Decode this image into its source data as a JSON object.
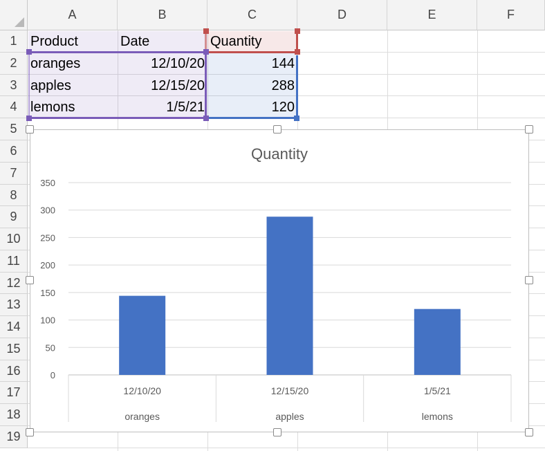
{
  "columns": [
    "A",
    "B",
    "C",
    "D",
    "E",
    "F"
  ],
  "rows": [
    "1",
    "2",
    "3",
    "4",
    "5",
    "6",
    "7",
    "8",
    "9",
    "10",
    "11",
    "12",
    "13",
    "14",
    "15",
    "16",
    "17",
    "18",
    "19"
  ],
  "table": {
    "headers": [
      "Product",
      "Date",
      "Quantity"
    ],
    "rows": [
      [
        "oranges",
        "12/10/20",
        "144"
      ],
      [
        "apples",
        "12/15/20",
        "288"
      ],
      [
        "lemons",
        "1/5/21",
        "120"
      ]
    ]
  },
  "colors": {
    "bar": "#4472c4",
    "range_categories": "#7a5cb8",
    "range_values": "#4472c4",
    "range_series_name": "#c0504d"
  },
  "chart_data": {
    "type": "bar",
    "title": "Quantity",
    "categories": [
      {
        "date": "12/10/20",
        "product": "oranges"
      },
      {
        "date": "12/15/20",
        "product": "apples"
      },
      {
        "date": "1/5/21",
        "product": "lemons"
      }
    ],
    "values": [
      144,
      288,
      120
    ],
    "ylim": [
      0,
      350
    ],
    "yticks": [
      "0",
      "50",
      "100",
      "150",
      "200",
      "250",
      "300",
      "350"
    ],
    "grid": true,
    "legend": "none"
  }
}
